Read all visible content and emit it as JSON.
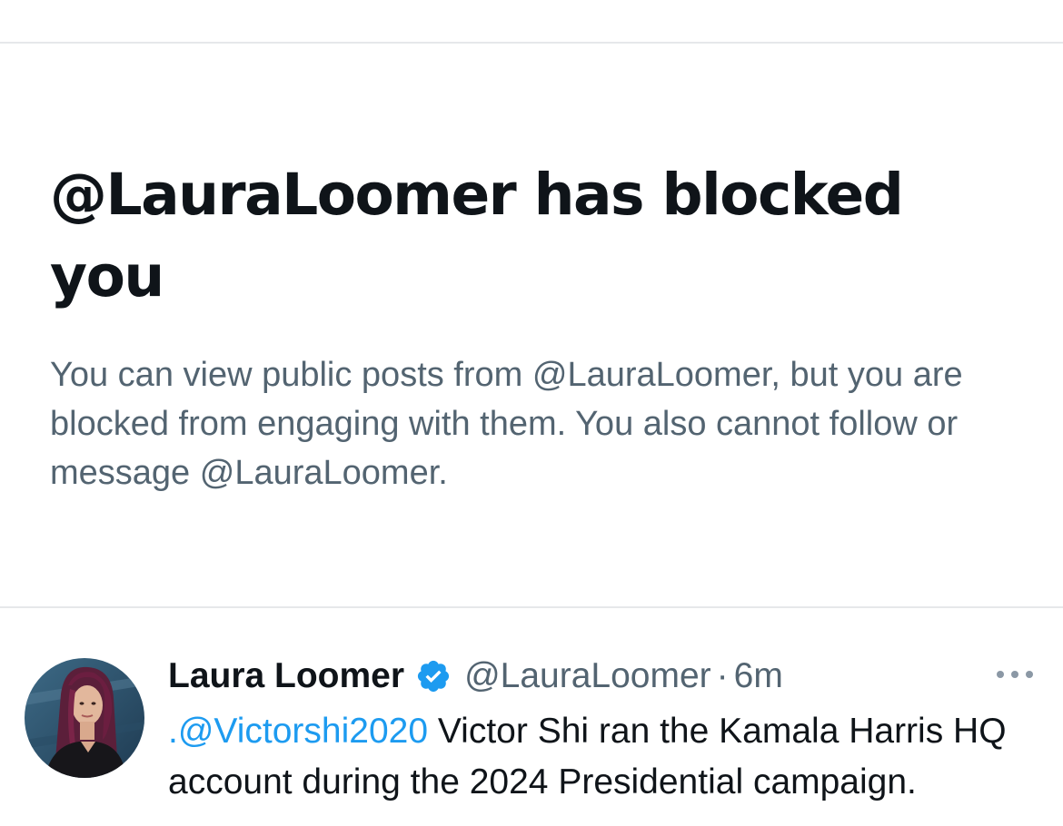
{
  "blocked_notice": {
    "title": "@LauraLoomer has blocked you",
    "description": "You can view public posts from @LauraLoomer, but you are blocked from engaging with them. You also cannot follow or message @LauraLoomer."
  },
  "tweet": {
    "author_name": "Laura Loomer",
    "verified": true,
    "handle": "@LauraLoomer",
    "separator": "·",
    "time": "6m",
    "mention": ".@Victorshi2020",
    "text": " Victor Shi ran the Kamala Harris HQ account during the 2024 Presidential campaign."
  },
  "icons": {
    "verified": "verified-badge-icon",
    "more": "more-options-icon"
  },
  "colors": {
    "link": "#1d9bf0",
    "verified": "#1d9bf0",
    "secondary_text": "#536471",
    "primary_text": "#0f1419",
    "divider": "#e6e8ea"
  }
}
